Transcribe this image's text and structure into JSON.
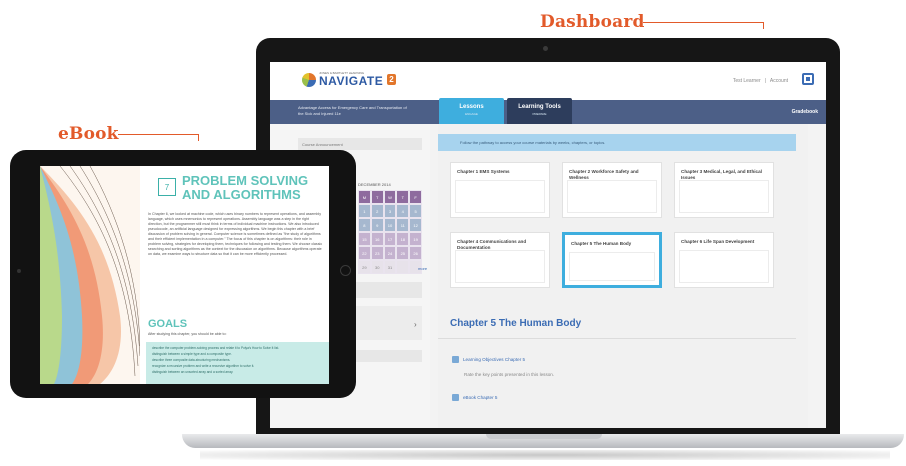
{
  "callouts": {
    "dashboard": "Dashboard",
    "ebook": "eBook"
  },
  "app": {
    "logo_sub": "JONES & BARTLETT LEARNING",
    "logo_text": "NAVIGATE",
    "logo_badge": "2",
    "header_links": [
      "Test Learner",
      "|",
      "Account"
    ],
    "course_title": "Advantage Access for Emergency Care and Transportation of the Sick and Injured 11e",
    "tabs": [
      {
        "label": "Lessons",
        "sub": "ENGAGE"
      },
      {
        "label": "Learning Tools",
        "sub": "PREPARE"
      }
    ],
    "gradebook": "Gradebook",
    "sidebar": {
      "field1": "Course Announcement",
      "line1": "Course Calendar",
      "cal_head": "",
      "cal_month": "DECEMBER 2014",
      "cal_days": [
        "M",
        "T",
        "W",
        "T",
        "F",
        "1",
        "2",
        "3",
        "4",
        "5",
        "8",
        "9",
        "10",
        "11",
        "12",
        "15",
        "16",
        "17",
        "18",
        "19",
        "22",
        "23",
        "24",
        "25",
        "26",
        "29",
        "30",
        "31",
        "",
        ""
      ],
      "more": "more",
      "field2": "Upcoming Quiz",
      "field3": ""
    },
    "banner": "Follow the pathway to access your course materials by weeks, chapters, or topics.",
    "cards": [
      {
        "title": "Chapter 1 EMS Systems"
      },
      {
        "title": "Chapter 2 Workforce Safety and Wellness"
      },
      {
        "title": "Chapter 3 Medical, Legal, and Ethical Issues"
      },
      {
        "title": "Chapter 4 Communications and Documentation"
      },
      {
        "title": "Chapter 5 The Human Body"
      },
      {
        "title": "Chapter 6 Life Span Development"
      }
    ],
    "chapter_heading": "Chapter 5 The Human Body",
    "lo_items": [
      {
        "label": "Learning Objectives Chapter 5",
        "sub": "Rate the key points presented in this lesson."
      },
      {
        "label": "eBook Chapter 5",
        "sub": ""
      }
    ]
  },
  "ebook": {
    "chapter_number": "7",
    "chapter_title": "PROBLEM SOLVING AND ALGORITHMS",
    "body": "In Chapter 6, we looked at machine code, which uses binary numbers to represent operations, and assembly language, which uses mnemonics to represent operations. Assembly language was a step in the right direction, but the programmer still must think in terms of individual machine instructions. We also introduced pseudocode, an artificial language designed for expressing algorithms. We begin this chapter with a brief discussion of problem solving in general. Computer science is sometimes defined as \"the study of algorithms and their efficient implementation in a computer.\" The focus of this chapter is on algorithms: their role in problem solving, strategies for developing them, techniques for following and testing them. We choose classic searching and sorting algorithms as the context for the discussion on algorithms. Because algorithms operate on data, we examine ways to structure data so that it can be more efficiently processed.",
    "goals_title": "GOALS",
    "goals_sub": "After studying this chapter, you should be able to:",
    "goals_items": [
      "describe the computer problem-solving process and relate it to Polya's How to Solve It list.",
      "distinguish between a simple type and a composite type.",
      "describe three composite data-structuring mechanisms.",
      "recognize a recursive problem and write a recursive algorithm to solve it.",
      "distinguish between an unsorted array and a sorted array."
    ]
  },
  "colors": {
    "accent": "#e25a2a",
    "nav": "#4c5f87",
    "tab_active": "#3eaede",
    "teal": "#5fc3ba"
  }
}
